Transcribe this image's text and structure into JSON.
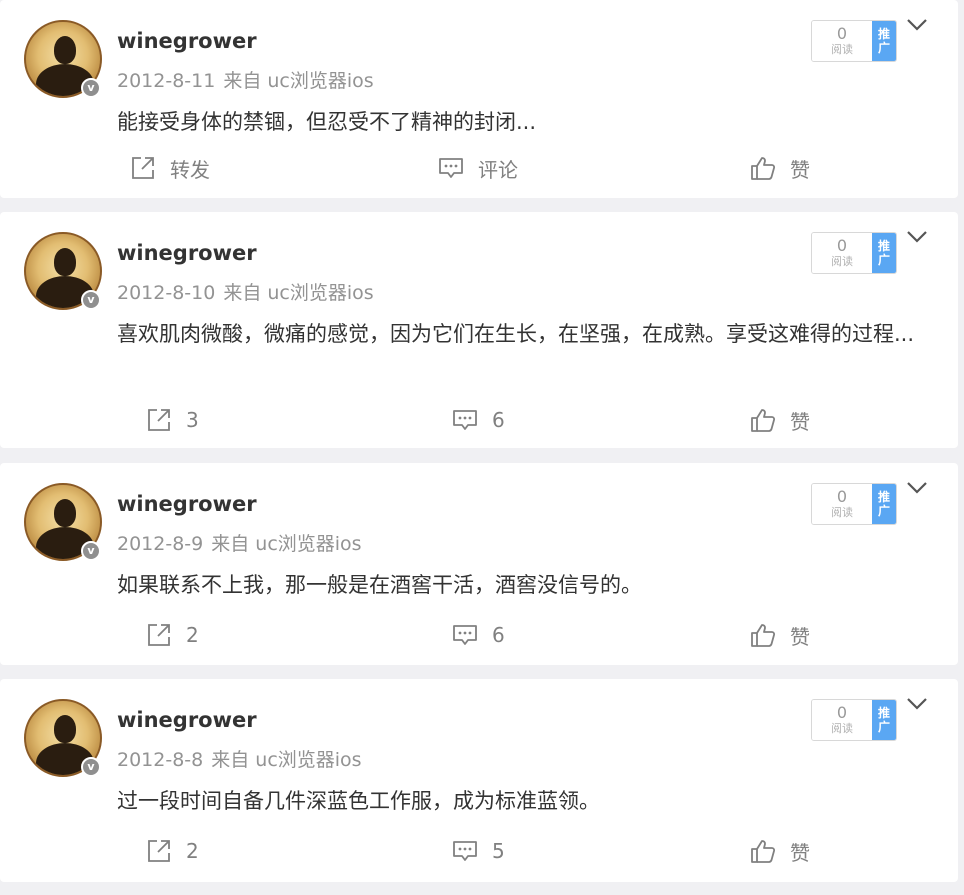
{
  "posts": [
    {
      "author": "winegrower",
      "date": "2012-8-11",
      "source": "来自 uc浏览器ios",
      "content": "能接受身体的禁锢，但忍受不了精神的封闭...",
      "read_count": "0",
      "read_label": "阅读",
      "promote_label_1": "推",
      "promote_label_2": "广",
      "verified_badge": "v",
      "repost_label": "转发",
      "comment_label": "评论",
      "like_label": "赞"
    },
    {
      "author": "winegrower",
      "date": "2012-8-10",
      "source": "来自 uc浏览器ios",
      "content": "喜欢肌肉微酸，微痛的感觉，因为它们在生长，在坚强，在成熟。享受这难得的过程...",
      "read_count": "0",
      "read_label": "阅读",
      "promote_label_1": "推",
      "promote_label_2": "广",
      "verified_badge": "v",
      "repost_label": "3",
      "comment_label": "6",
      "like_label": "赞"
    },
    {
      "author": "winegrower",
      "date": "2012-8-9",
      "source": "来自 uc浏览器ios",
      "content": "如果联系不上我，那一般是在酒窖干活，酒窖没信号的。",
      "read_count": "0",
      "read_label": "阅读",
      "promote_label_1": "推",
      "promote_label_2": "广",
      "verified_badge": "v",
      "repost_label": "2",
      "comment_label": "6",
      "like_label": "赞"
    },
    {
      "author": "winegrower",
      "date": "2012-8-8",
      "source": "来自 uc浏览器ios",
      "content": "过一段时间自备几件深蓝色工作服，成为标准蓝领。",
      "read_count": "0",
      "read_label": "阅读",
      "promote_label_1": "推",
      "promote_label_2": "广",
      "verified_badge": "v",
      "repost_label": "2",
      "comment_label": "5",
      "like_label": "赞"
    }
  ],
  "icons": {
    "repost": "share-icon",
    "comment": "comment-icon",
    "like": "thumbs-up-icon",
    "menu": "chevron-down-icon"
  },
  "colors": {
    "page_background": "#f0f0f3",
    "card_background": "#ffffff",
    "promote_blue": "#5aa7f3",
    "muted_text": "#939393"
  }
}
